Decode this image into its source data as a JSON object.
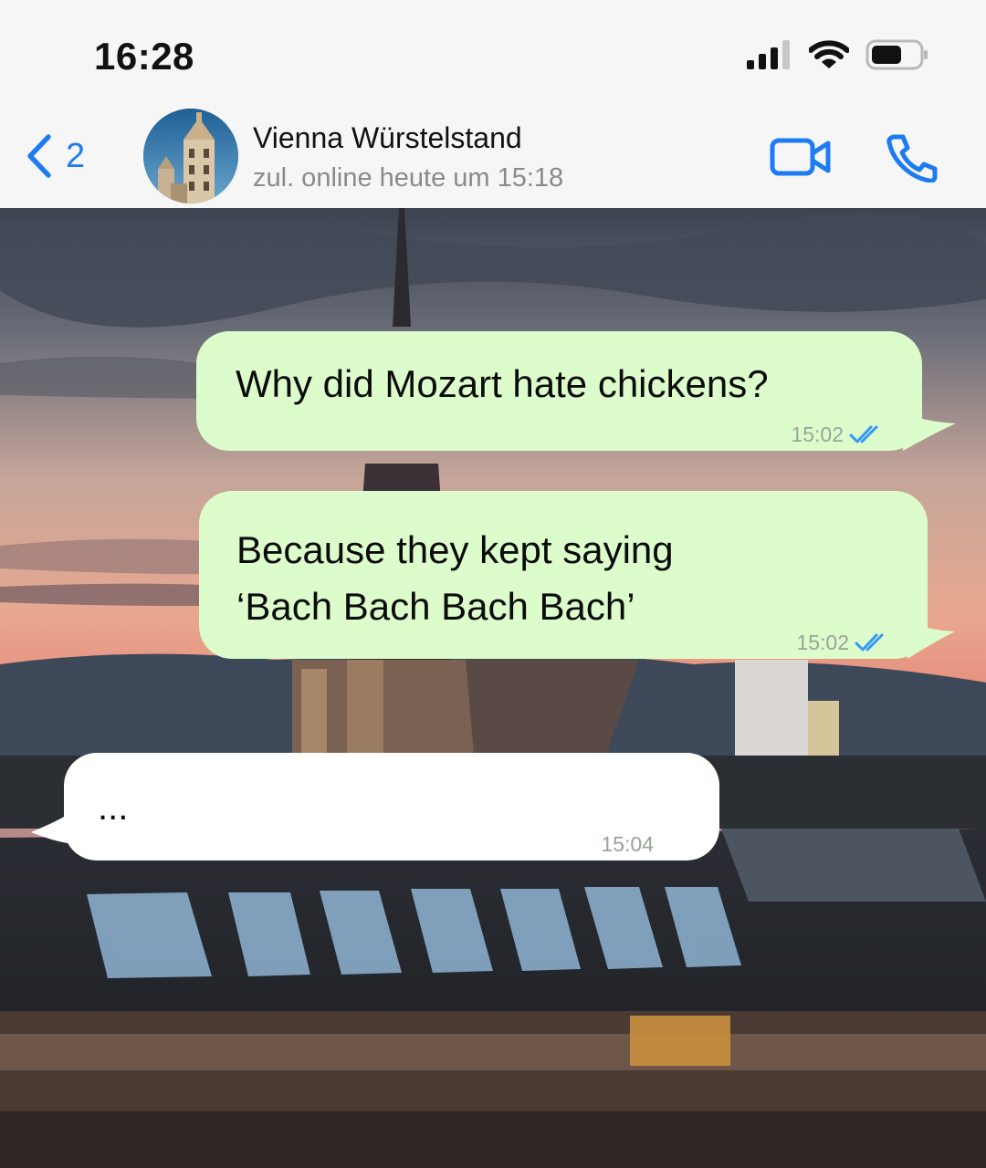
{
  "status_bar": {
    "time": "16:28"
  },
  "header": {
    "back_count": "2",
    "contact_name": "Vienna Würstelstand",
    "contact_status": "zul. online heute um 15:18"
  },
  "messages": [
    {
      "direction": "outgoing",
      "lines": [
        "Why did Mozart hate chickens?"
      ],
      "time": "15:02",
      "read": true
    },
    {
      "direction": "outgoing",
      "lines": [
        "Because they kept saying",
        "‘Bach Bach Bach Bach’"
      ],
      "time": "15:02",
      "read": true
    },
    {
      "direction": "incoming",
      "lines": [
        "..."
      ],
      "time": "15:04"
    }
  ],
  "icons": {
    "back": "chevron-left-icon",
    "video": "video-camera-icon",
    "call": "phone-icon",
    "read": "double-check-icon"
  },
  "colors": {
    "accent": "#1d7cf2",
    "outgoing_bubble": "#dcfdcb",
    "incoming_bubble": "#ffffff",
    "read_tick": "#3497f9"
  }
}
